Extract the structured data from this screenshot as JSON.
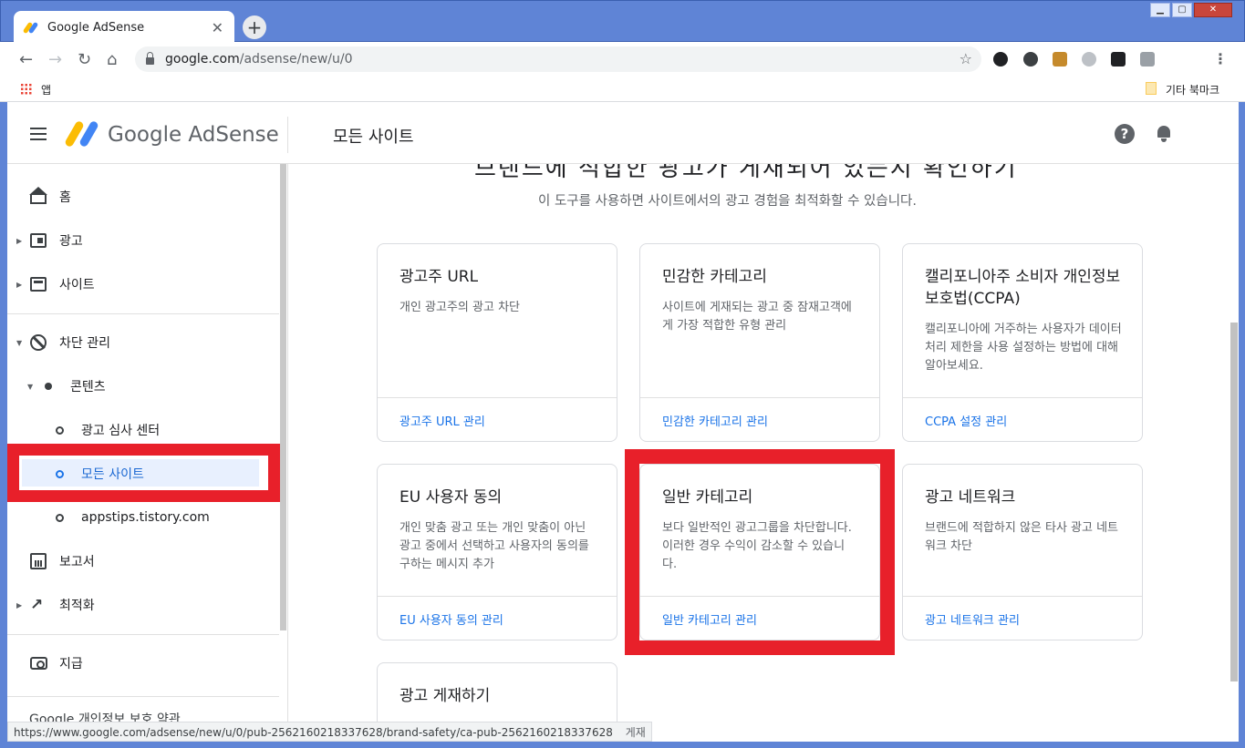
{
  "browser": {
    "tab_title": "Google AdSense",
    "tab_close": "✕",
    "new_tab": "+",
    "url_host": "google.com",
    "url_path": "/adsense/new/u/0",
    "bookmarks_apps": "앱",
    "bookmarks_other": "기타 북마크"
  },
  "header": {
    "logo_text": "Google AdSense",
    "page_title": "모든 사이트",
    "help": "?"
  },
  "sidebar": {
    "home": "홈",
    "ads": "광고",
    "sites": "사이트",
    "blocking": "차단 관리",
    "content": "콘텐츠",
    "ad_review": "광고 심사 센터",
    "all_sites": "모든 사이트",
    "site_domain": "appstips.tistory.com",
    "reports": "보고서",
    "optimize": "최적화",
    "payments": "지급",
    "footer": "Google  개인정보 보호  약관"
  },
  "main": {
    "title_clipped": "브랜드에 적합한 광고가 게재되어 있는지 확인하기",
    "subtitle": "이 도구를 사용하면 사이트에서의 광고 경험을 최적화할 수 있습니다.",
    "cards": [
      {
        "title": "광고주 URL",
        "desc": "개인 광고주의 광고 차단",
        "link": "광고주 URL 관리"
      },
      {
        "title": "민감한 카테고리",
        "desc": "사이트에 게재되는 광고 중 잠재고객에게 가장 적합한 유형 관리",
        "link": "민감한 카테고리 관리"
      },
      {
        "title": "캘리포니아주 소비자 개인정보 보호법(CCPA)",
        "desc": "캘리포니아에 거주하는 사용자가 데이터 처리 제한을 사용 설정하는 방법에 대해 알아보세요.",
        "link": "CCPA 설정 관리"
      },
      {
        "title": "EU 사용자 동의",
        "desc": "개인 맞춤 광고 또는 개인 맞춤이 아닌 광고 중에서 선택하고 사용자의 동의를 구하는 메시지 추가",
        "link": "EU 사용자 동의 관리"
      },
      {
        "title": "일반 카테고리",
        "desc": "보다 일반적인 광고그룹을 차단합니다. 이러한 경우 수익이 감소할 수 있습니다.",
        "link": "일반 카테고리 관리"
      },
      {
        "title": "광고 네트워크",
        "desc": "브랜드에 적합하지 않은 타사 광고 네트워크 차단",
        "link": "광고 네트워크 관리"
      },
      {
        "title": "광고 게재하기",
        "desc": "",
        "link": ""
      }
    ]
  },
  "status_bar": "https://www.google.com/adsense/new/u/0/pub-2562160218337628/brand-safety/ca-pub-2562160218337628",
  "status_suffix": "게재",
  "colors": {
    "accent": "#1a73e8",
    "highlight": "#e8202a",
    "chrome": "#5f84d6"
  }
}
